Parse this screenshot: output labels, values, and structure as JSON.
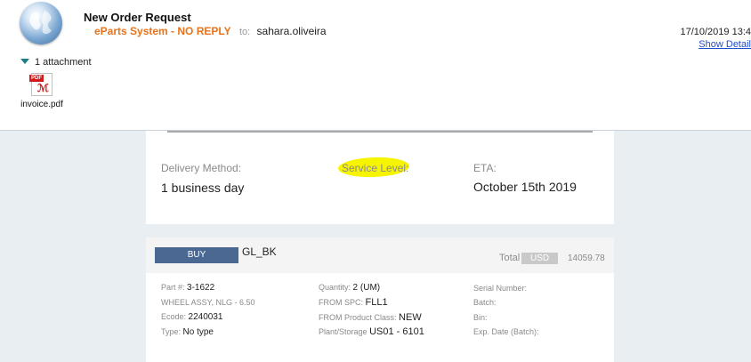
{
  "email": {
    "subject": "New Order Request",
    "sender": "eParts System - NO REPLY",
    "to_label": "to:",
    "recipient": "sahara.oliveira",
    "date": "17/10/2019 13:4",
    "show_details": "Show Detail",
    "attachments_toggle": "1 attachment",
    "attachment": {
      "name": "invoice.pdf",
      "badge": "PDF",
      "icon": "pdf-file-icon"
    }
  },
  "delivery": {
    "method_label": "Delivery Method:",
    "method_value": "1 business day",
    "service_level_label": "Service Level:",
    "service_level_highlight": "#f7f400",
    "eta_label": "ETA:",
    "eta_value": "October 15th 2019"
  },
  "order": {
    "buy_label": "BUY",
    "gl_code": "GL_BK",
    "total_label": "Total",
    "currency": "USD",
    "total_value": "14059.78",
    "left_fields": {
      "part_label": "Part #:",
      "part_value": "3-1622",
      "description": "WHEEL ASSY, NLG - 6.50",
      "ecode_label": "Ecode:",
      "ecode_value": "2240031",
      "type_label": "Type:",
      "type_value": "No type"
    },
    "mid_fields": {
      "quantity_label": "Quantity:",
      "quantity_value": "2 (UM)",
      "spc_label": "FROM SPC:",
      "spc_value": "FLL1",
      "class_label": "FROM Product Class:",
      "class_value": "NEW",
      "plant_label": "Plant/Storage",
      "plant_value": "US01 - 6101"
    },
    "right_fields": {
      "serial_label": "Serial Number:",
      "batch_label": "Batch:",
      "bin_label": "Bin:",
      "exp_label": "Exp. Date (Batch):"
    }
  },
  "colors": {
    "sender": "#e8731a",
    "link": "#1f4fd1",
    "buy_button": "#4a6892",
    "body_bg": "#e9eef2"
  }
}
